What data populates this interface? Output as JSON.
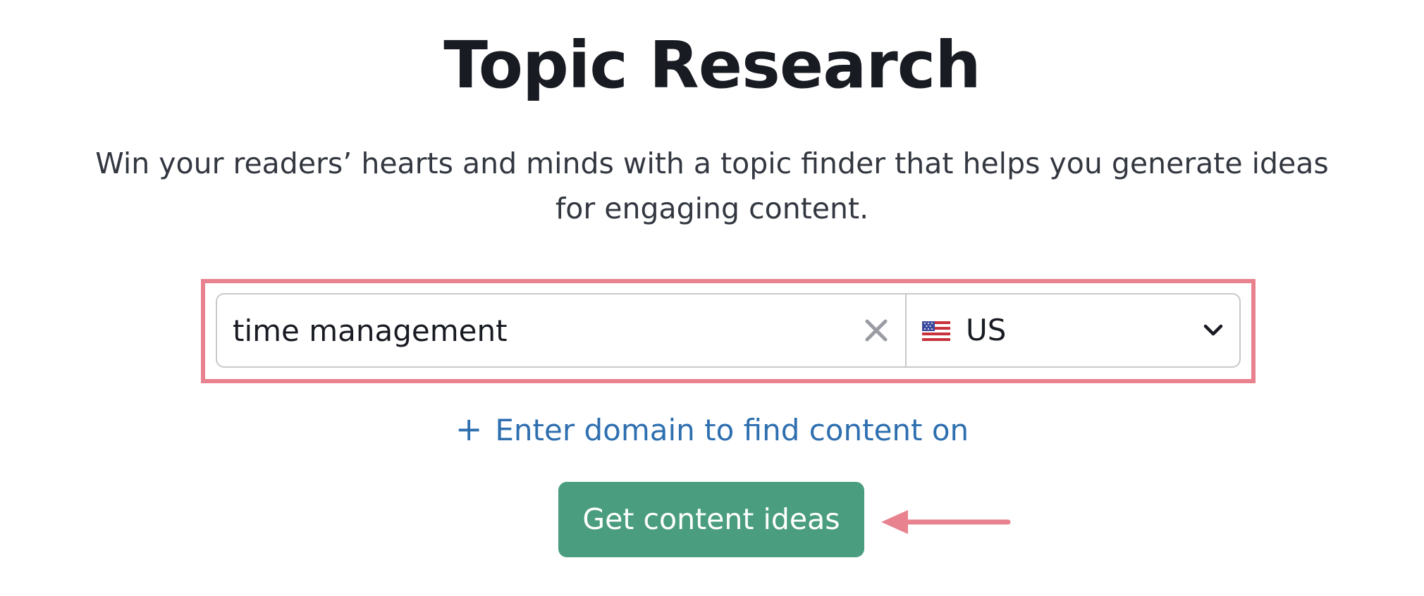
{
  "header": {
    "title": "Topic Research",
    "subtitle": "Win your readers’ hearts and minds with a topic finder that helps you generate ideas for engaging content."
  },
  "search": {
    "keyword_value": "time management",
    "clear_icon": "close-icon",
    "country": {
      "flag_icon": "us-flag-icon",
      "label": "US",
      "dropdown_icon": "chevron-down-icon"
    }
  },
  "domain_link": {
    "icon": "plus-icon",
    "icon_glyph": "+",
    "label": "Enter domain to find content on"
  },
  "cta": {
    "label": "Get content ideas"
  },
  "colors": {
    "highlight": "#e8828f",
    "button": "#4a9d7f",
    "link": "#2e6fb0",
    "title": "#191b23"
  }
}
